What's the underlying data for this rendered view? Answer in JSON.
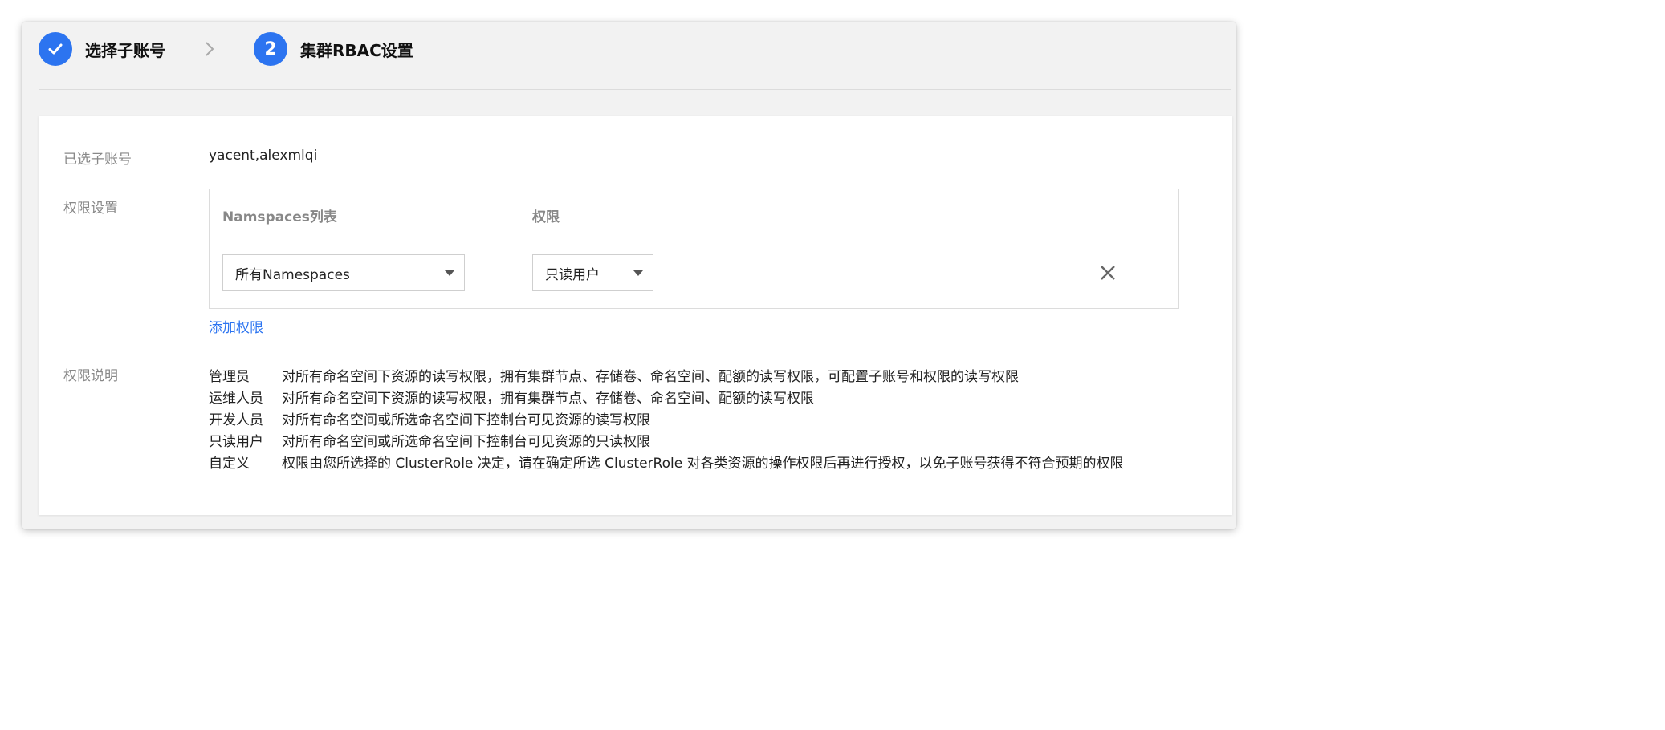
{
  "steps": [
    {
      "state": "done",
      "icon": "check-icon",
      "title": "选择子账号"
    },
    {
      "state": "active",
      "number": "2",
      "title": "集群RBAC设置"
    }
  ],
  "form": {
    "selected_accounts_label": "已选子账号",
    "selected_accounts_value": "yacent,alexmlqi",
    "permission_label": "权限设置",
    "table": {
      "headers": {
        "namespaces": "Namspaces列表",
        "permission": "权限"
      },
      "rows": [
        {
          "namespace": "所有Namespaces",
          "permission": "只读用户"
        }
      ]
    },
    "add_permission_label": "添加权限",
    "explanation_label": "权限说明",
    "explanations": [
      {
        "role": "管理员",
        "text": "对所有命名空间下资源的读写权限，拥有集群节点、存储卷、命名空间、配额的读写权限，可配置子账号和权限的读写权限"
      },
      {
        "role": "运维人员",
        "text": "对所有命名空间下资源的读写权限，拥有集群节点、存储卷、命名空间、配额的读写权限"
      },
      {
        "role": "开发人员",
        "text": "对所有命名空间或所选命名空间下控制台可见资源的读写权限"
      },
      {
        "role": "只读用户",
        "text": "对所有命名空间或所选命名空间下控制台可见资源的只读权限"
      },
      {
        "role": "自定义",
        "text": "权限由您所选择的 ClusterRole 决定，请在确定所选 ClusterRole 对各类资源的操作权限后再进行授权，以免子账号获得不符合预期的权限"
      }
    ]
  },
  "colors": {
    "accent": "#2c74f0",
    "background": "#f2f2f2",
    "panel": "#ffffff",
    "label": "#888888"
  }
}
